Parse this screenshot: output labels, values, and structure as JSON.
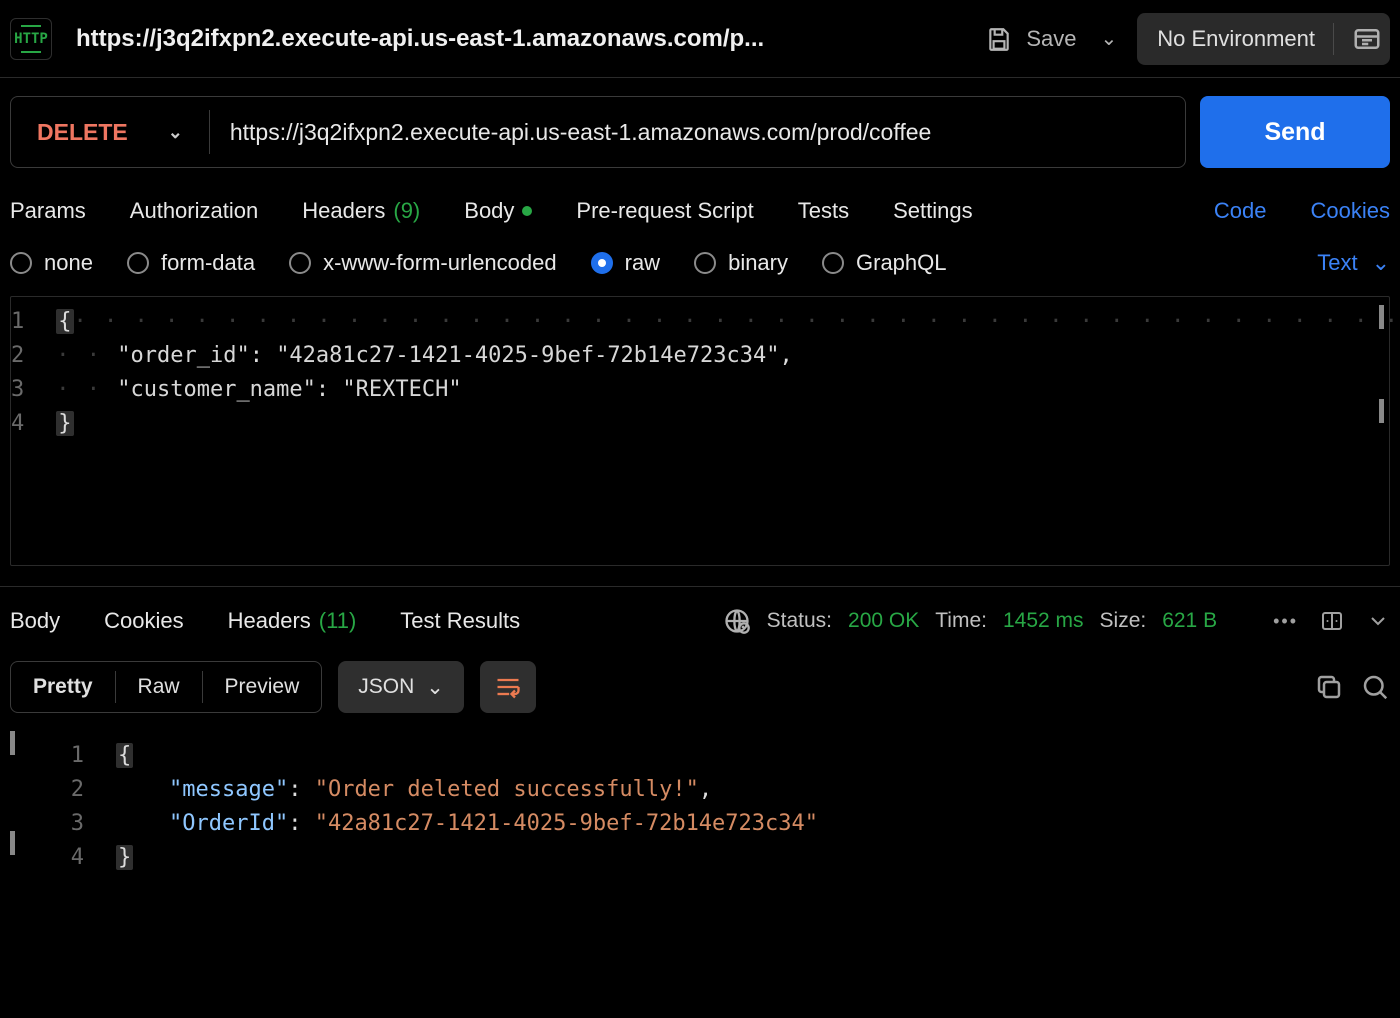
{
  "topbar": {
    "badge": "HTTP",
    "tab_title": "https://j3q2ifxpn2.execute-api.us-east-1.amazonaws.com/p...",
    "save": "Save",
    "environment": "No Environment"
  },
  "request": {
    "method": "DELETE",
    "url": "https://j3q2ifxpn2.execute-api.us-east-1.amazonaws.com/prod/coffee",
    "send": "Send"
  },
  "config_tabs": {
    "params": "Params",
    "authorization": "Authorization",
    "headers": "Headers",
    "headers_count": "(9)",
    "body": "Body",
    "prerequest": "Pre-request Script",
    "tests": "Tests",
    "settings": "Settings",
    "code": "Code",
    "cookies": "Cookies"
  },
  "body_types": {
    "none": "none",
    "form_data": "form-data",
    "urlencoded": "x-www-form-urlencoded",
    "raw": "raw",
    "binary": "binary",
    "graphql": "GraphQL",
    "text": "Text"
  },
  "request_body": {
    "line1": "{",
    "line2_key": "\"order_id\"",
    "line2_val": "\"42a81c27-1421-4025-9bef-72b14e723c34\"",
    "line3_key": "\"customer_name\"",
    "line3_val": "\"REXTECH\"",
    "line4": "}",
    "lines": [
      "1",
      "2",
      "3",
      "4"
    ]
  },
  "response_tabs": {
    "body": "Body",
    "cookies": "Cookies",
    "headers": "Headers",
    "headers_count": "(11)",
    "test_results": "Test Results"
  },
  "status": {
    "status_label": "Status:",
    "status_val": "200 OK",
    "time_label": "Time:",
    "time_val": "1452 ms",
    "size_label": "Size:",
    "size_val": "621 B"
  },
  "resp_view": {
    "pretty": "Pretty",
    "raw": "Raw",
    "preview": "Preview",
    "json": "JSON"
  },
  "response_body": {
    "line1": "{",
    "line2_key": "\"message\"",
    "line2_val": "\"Order deleted successfully!\"",
    "line3_key": "\"OrderId\"",
    "line3_val": "\"42a81c27-1421-4025-9bef-72b14e723c34\"",
    "line4": "}",
    "lines": [
      "1",
      "2",
      "3",
      "4"
    ]
  }
}
